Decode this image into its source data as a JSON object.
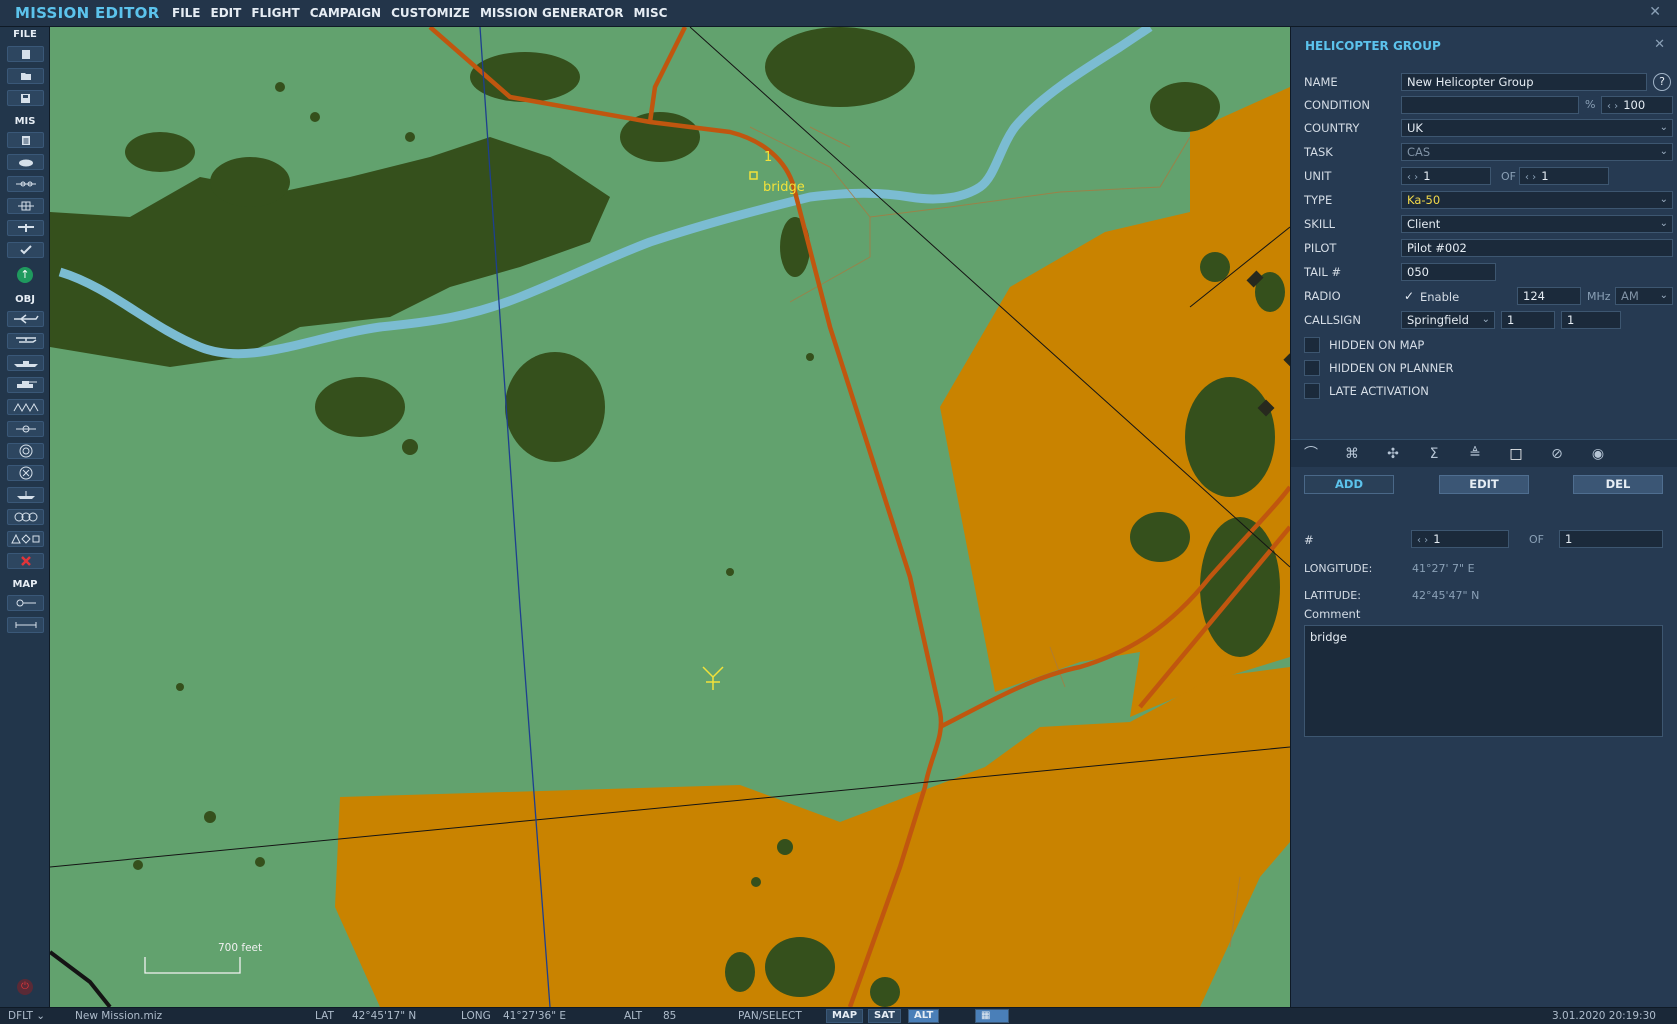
{
  "app": {
    "title": "MISSION EDITOR",
    "menu": [
      "FILE",
      "EDIT",
      "FLIGHT",
      "CAMPAIGN",
      "CUSTOMIZE",
      "MISSION GENERATOR",
      "MISC"
    ]
  },
  "toolbar": {
    "sections": {
      "file": "FILE",
      "mis": "MIS",
      "obj": "OBJ",
      "map": "MAP"
    }
  },
  "map": {
    "waypoint_number": "1",
    "waypoint_label": "bridge",
    "scale_label": "700 feet"
  },
  "panel": {
    "title": "HELICOPTER GROUP",
    "labels": {
      "name": "NAME",
      "condition": "CONDITION",
      "country": "COUNTRY",
      "task": "TASK",
      "unit": "UNIT",
      "type": "TYPE",
      "skill": "SKILL",
      "pilot": "PILOT",
      "tail": "TAIL #",
      "radio": "RADIO",
      "callsign": "CALLSIGN"
    },
    "name": "New Helicopter Group",
    "help": "?",
    "condition_value": "",
    "condition_unit": "%",
    "condition_percent": "100",
    "country": "UK",
    "task": "CAS",
    "unit_value": "1",
    "unit_of_label": "OF",
    "unit_total": "1",
    "type": "Ka-50",
    "skill": "Client",
    "pilot": "Pilot #002",
    "tail": "050",
    "radio_enable_label": "Enable",
    "radio_frequency": "124",
    "radio_unit": "MHz",
    "radio_modulation": "AM",
    "callsign_name": "Springfield",
    "callsign_number_1": "1",
    "callsign_number_2": "1",
    "checkboxes": {
      "hidden_on_map": "HIDDEN ON MAP",
      "hidden_on_planner": "HIDDEN ON PLANNER",
      "late_activation": "LATE ACTIVATION"
    },
    "buttons": {
      "add": "ADD",
      "edit": "EDIT",
      "del": "DEL"
    },
    "waypoint": {
      "index_label": "#",
      "index_value": "1",
      "of_label": "OF",
      "total": "1",
      "longitude_label": "LONGITUDE:",
      "longitude": "41°27' 7\" E",
      "latitude_label": "LATITUDE:",
      "latitude": "42°45'47\" N",
      "comment_label": "Comment",
      "comment": "bridge"
    }
  },
  "statusbar": {
    "selector": "DFLT",
    "file": "New Mission.miz",
    "lat_label": "LAT",
    "lat": "42°45'17\" N",
    "long_label": "LONG",
    "long": "41°27'36\" E",
    "alt_label": "ALT",
    "alt": "85",
    "mode": "PAN/SELECT",
    "map_btn": "MAP",
    "sat_btn": "SAT",
    "alt_btn": "ALT",
    "datetime": "3.01.2020 20:19:30"
  },
  "colors": {
    "accent": "#5cc3ec",
    "terrain": "#62a26e",
    "urban": "#c98300",
    "forest": "#35501c",
    "road": "#c0560f",
    "water": "#7bbcd2",
    "waypoint": "#f2e23a"
  }
}
